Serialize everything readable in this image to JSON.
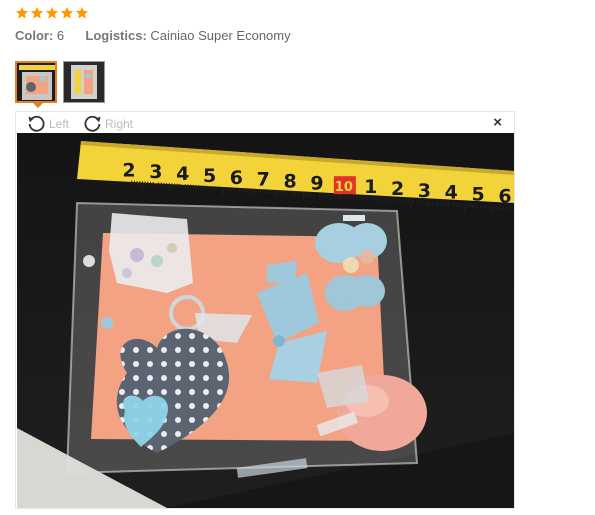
{
  "review": {
    "rating": 5,
    "color_label": "Color:",
    "color_value": "6",
    "logistics_label": "Logistics:",
    "logistics_value": "Cainiao Super Economy"
  },
  "thumbnails": [
    {
      "name": "thumbnail-1",
      "selected": true
    },
    {
      "name": "thumbnail-2",
      "selected": false
    }
  ],
  "viewer": {
    "rotate_left_label": "Left",
    "rotate_right_label": "Right",
    "close_glyph": "×",
    "ruler_numbers": [
      "2",
      "3",
      "4",
      "5",
      "6",
      "7",
      "8",
      "9",
      "10",
      "1",
      "2",
      "3",
      "4",
      "5",
      "6"
    ]
  },
  "colors": {
    "star": "#ff9900",
    "accent": "#e67e22",
    "ruler_yellow": "#f2d43a",
    "ruler_highlight": "#e2302a",
    "card_pink": "#f3a384",
    "heart_gray": "#5b6470",
    "bow_blue": "#9ec9dd"
  },
  "icons": {
    "rating_star": "star-icon",
    "rotate_left": "rotate-left-icon",
    "rotate_right": "rotate-right-icon",
    "close": "close-icon"
  }
}
